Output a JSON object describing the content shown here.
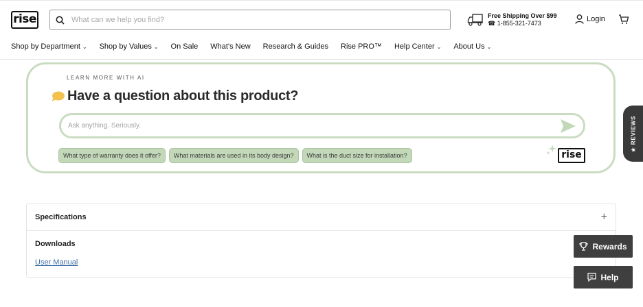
{
  "brand": {
    "logo_text": "rise"
  },
  "search": {
    "placeholder": "What can we help you find?"
  },
  "shipping": {
    "title": "Free Shipping Over $99",
    "phone": "☎ 1-855-321-7473"
  },
  "account": {
    "login_label": "Login"
  },
  "nav": [
    {
      "label": "Shop by Department",
      "has_dropdown": true
    },
    {
      "label": "Shop by Values",
      "has_dropdown": true
    },
    {
      "label": "On Sale",
      "has_dropdown": false
    },
    {
      "label": "What's New",
      "has_dropdown": false
    },
    {
      "label": "Research & Guides",
      "has_dropdown": false
    },
    {
      "label": "Rise PRO™",
      "has_dropdown": false
    },
    {
      "label": "Help Center",
      "has_dropdown": true
    },
    {
      "label": "About Us",
      "has_dropdown": true
    }
  ],
  "ai": {
    "eyebrow": "LEARN MORE WITH AI",
    "title": "Have a question about this product?",
    "input_placeholder": "Ask anything. Seriously.",
    "suggestions": [
      "What type of warranty does it offer?",
      "What materials are used in its body design?",
      "What is the duct size for installation?"
    ],
    "logo_text": "rise"
  },
  "reviews_tab": {
    "label": "★ REVIEWS"
  },
  "specs": {
    "specifications_label": "Specifications",
    "downloads_label": "Downloads",
    "user_manual_label": "User Manual",
    "toggle_symbol": "+"
  },
  "floating": {
    "rewards_label": "Rewards",
    "help_label": "Help"
  },
  "colors": {
    "accent_green": "#c9dcc2",
    "chip_green": "#c2d8b9",
    "dark_button": "#3f3f3f",
    "link_blue": "#3d6ea5"
  }
}
